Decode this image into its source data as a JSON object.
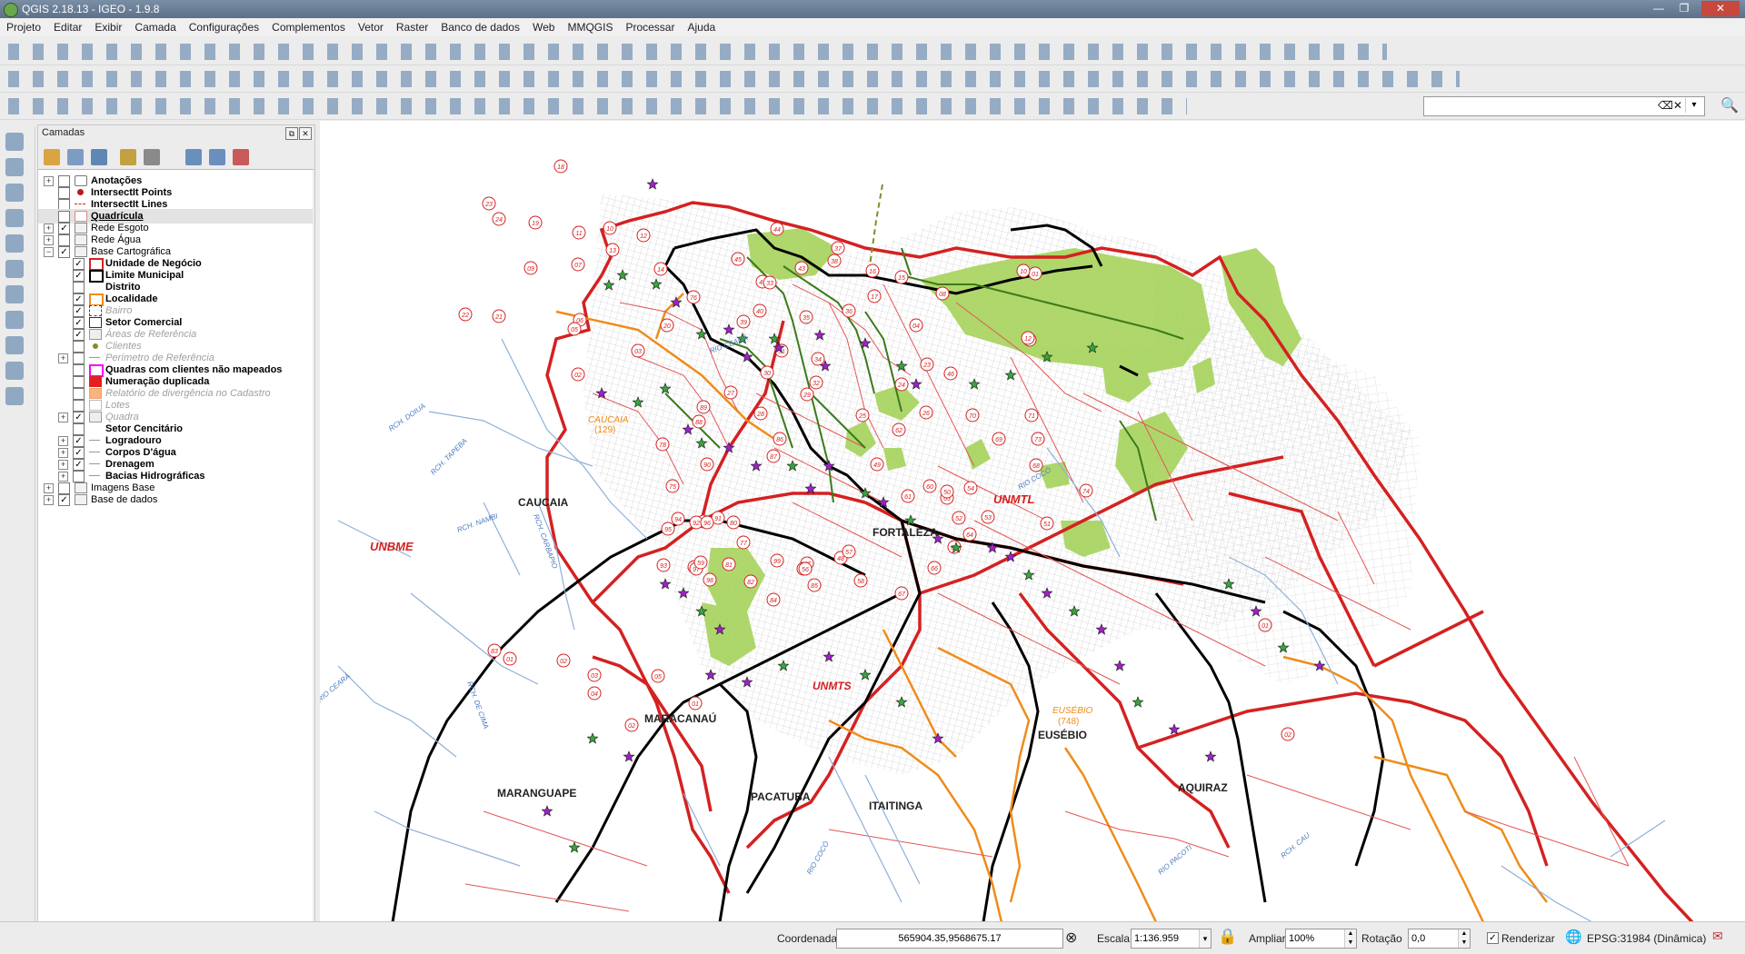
{
  "window": {
    "title": "QGIS 2.18.13 - IGEO - 1.9.8",
    "minimize": "—",
    "maximize": "❐",
    "close": "✕"
  },
  "menu": [
    "Projeto",
    "Editar",
    "Exibir",
    "Camada",
    "Configurações",
    "Complementos",
    "Vetor",
    "Raster",
    "Banco de dados",
    "Web",
    "MMQGIS",
    "Processar",
    "Ajuda"
  ],
  "search": {
    "value": "",
    "clear_icon": "⌫✕",
    "dropdown": "▾",
    "go_icon": "🔍"
  },
  "layers_panel": {
    "title": "Camadas",
    "float_btn": "⧉",
    "close_btn": "✕",
    "items": [
      {
        "label": "Anotações",
        "bold": true,
        "expand": "+",
        "checked": false,
        "symbol": "annotation"
      },
      {
        "label": "IntersectIt Points",
        "bold": true,
        "checked": false,
        "symbol": "point-red"
      },
      {
        "label": "IntersectIt Lines",
        "bold": true,
        "checked": false,
        "symbol": "line-red-dash"
      },
      {
        "label": "Quadrícula",
        "bold": true,
        "underline": true,
        "checked": false,
        "symbol": "poly-pink",
        "selected": true
      },
      {
        "label": "Rede Esgoto",
        "expand": "+",
        "checked": true,
        "symbol": "group"
      },
      {
        "label": "Rede Água",
        "expand": "+",
        "checked": false,
        "symbol": "group"
      },
      {
        "label": "Base Cartográfica",
        "expand": "−",
        "checked": true,
        "symbol": "group"
      },
      {
        "label": "Unidade de Negócio",
        "bold": true,
        "checked": true,
        "symbol": "poly-red",
        "indent": 1
      },
      {
        "label": "Limite Municipal",
        "bold": true,
        "checked": true,
        "symbol": "poly-black",
        "indent": 1
      },
      {
        "label": "Distrito",
        "bold": true,
        "checked": false,
        "symbol": "none",
        "indent": 1
      },
      {
        "label": "Localidade",
        "bold": true,
        "checked": true,
        "symbol": "poly-orange",
        "indent": 1
      },
      {
        "label": "Bairro",
        "dim": true,
        "checked": true,
        "symbol": "poly-dash",
        "indent": 1
      },
      {
        "label": "Setor Comercial",
        "bold": true,
        "checked": true,
        "symbol": "poly-black-thin",
        "indent": 1
      },
      {
        "label": "Áreas de Referência",
        "dim": true,
        "checked": true,
        "symbol": "poly-grey",
        "indent": 1
      },
      {
        "label": "Clientes",
        "dim": true,
        "checked": false,
        "symbol": "point-olive",
        "indent": 1
      },
      {
        "label": "Perímetro de Referência",
        "dim": true,
        "expand": "+",
        "checked": false,
        "symbol": "line-grey",
        "indent": 1
      },
      {
        "label": "Quadras com clientes não mapeados",
        "bold": true,
        "checked": false,
        "symbol": "poly-magenta",
        "indent": 1
      },
      {
        "label": "Numeração duplicada",
        "bold": true,
        "checked": false,
        "symbol": "poly-red-fill",
        "indent": 1
      },
      {
        "label": "Relatório de divergência no Cadastro",
        "dim": true,
        "checked": false,
        "symbol": "poly-salmon",
        "indent": 1
      },
      {
        "label": "Lotes",
        "dim": true,
        "checked": false,
        "symbol": "poly-white",
        "indent": 1
      },
      {
        "label": "Quadra",
        "dim": true,
        "expand": "+",
        "checked": true,
        "symbol": "poly-grey",
        "indent": 1
      },
      {
        "label": "Setor Cencitário",
        "bold": true,
        "checked": false,
        "symbol": "none",
        "indent": 1
      },
      {
        "label": "Logradouro",
        "bold": true,
        "expand": "+",
        "checked": true,
        "symbol": "line-grey",
        "indent": 1
      },
      {
        "label": "Corpos D'água",
        "bold": true,
        "expand": "+",
        "checked": true,
        "symbol": "line-grey",
        "indent": 1
      },
      {
        "label": "Drenagem",
        "bold": true,
        "expand": "+",
        "checked": true,
        "symbol": "line-grey",
        "indent": 1
      },
      {
        "label": "Bacias Hidrográficas",
        "bold": true,
        "expand": "+",
        "checked": false,
        "symbol": "line-grey",
        "indent": 1
      },
      {
        "label": "Imagens Base",
        "expand": "+",
        "checked": false,
        "symbol": "group"
      },
      {
        "label": "Base de dados",
        "expand": "+",
        "checked": true,
        "symbol": "group"
      }
    ]
  },
  "map": {
    "labels": {
      "caucaia": "CAUCAIA",
      "caucaia_loc": "CAUCAIA",
      "caucaia_code": "(129)",
      "fortaleza": "FORTALEZA",
      "maracanau": "MARACANAÚ",
      "maranguape": "MARANGUAPE",
      "pacatuba": "PACATUBA",
      "itaitinga": "ITAITINGA",
      "eusebio": "EUSÉBIO",
      "eusebio_loc": "EUSÉBIO",
      "eusebio_code": "(748)",
      "aquiraz": "AQUIRAZ",
      "unbme": "UNBME",
      "unmtl": "UNMTL",
      "unmts": "UNMTS",
      "rio_ceara": "RIO CEARÁ",
      "rio_ceara2": "RIO CEARÁ",
      "rch_doiua": "RCH. DOIUA",
      "rch_tapeba": "RCH. TAPEBA",
      "rch_nambi": "RCH. NAMBI",
      "rch_cambeba": "RCH. CARBAPIO",
      "rch_de_cima": "RCH. DE CIMA",
      "rio_coco": "RIO COCÓ",
      "rio_coco2": "RIO COCÓ",
      "rio_pacoti": "RIO PACOTI",
      "rch_cau": "RCH. CAU"
    },
    "sector_numbers": [
      "18",
      "23",
      "24",
      "19",
      "11",
      "10",
      "12",
      "13",
      "09",
      "14",
      "07",
      "20",
      "22",
      "21",
      "06",
      "03",
      "05",
      "02",
      "76",
      "16",
      "15",
      "17",
      "45",
      "44",
      "37",
      "38",
      "43",
      "40",
      "41",
      "39",
      "36",
      "35",
      "33",
      "34",
      "32",
      "31",
      "30",
      "29",
      "28",
      "27",
      "25",
      "26",
      "24",
      "23",
      "04",
      "08",
      "01",
      "10",
      "11",
      "12",
      "46",
      "70",
      "71",
      "73",
      "69",
      "62",
      "61",
      "60",
      "63",
      "64",
      "65",
      "66",
      "67",
      "68",
      "74",
      "72",
      "75",
      "78",
      "79",
      "82",
      "84",
      "85",
      "86",
      "87",
      "88",
      "89",
      "90",
      "91",
      "92",
      "93",
      "94",
      "95",
      "96",
      "97",
      "98",
      "99",
      "47",
      "48",
      "49",
      "50",
      "51",
      "52",
      "53",
      "54",
      "55",
      "56",
      "57",
      "58",
      "59",
      "77",
      "80",
      "81",
      "83",
      "01",
      "02",
      "03",
      "04",
      "05",
      "02",
      "01",
      "01",
      "02"
    ]
  },
  "status": {
    "coord_label": "Coordenada",
    "coord_value": "565904.35,9568675.17",
    "scale_label": "Escala",
    "scale_value": "1:136.959",
    "magnify_label": "Ampliar",
    "magnify_value": "100%",
    "rotation_label": "Rotação",
    "rotation_value": "0,0",
    "render_label": "Renderizar",
    "render_checked": "✓",
    "crs_value": "EPSG:31984 (Dinâmica)"
  }
}
